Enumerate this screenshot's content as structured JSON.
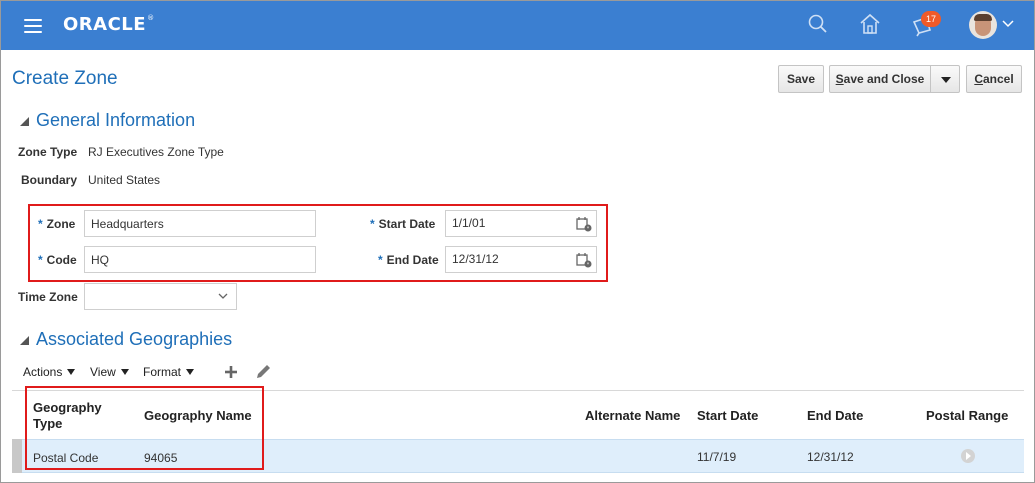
{
  "header": {
    "logo": "ORACLE",
    "logo_mark": "®",
    "notification_count": "17",
    "icons": [
      "menu-icon",
      "search-icon",
      "home-icon",
      "notifications-icon",
      "avatar",
      "chevron-down-icon"
    ]
  },
  "page": {
    "title": "Create Zone",
    "buttons": {
      "save": "Save",
      "save_and_close": "Save and Close",
      "cancel": "Cancel"
    }
  },
  "general_info": {
    "heading": "General Information",
    "zone_type_label": "Zone Type",
    "zone_type_value": "RJ Executives Zone Type",
    "boundary_label": "Boundary",
    "boundary_value": "United States",
    "required_mark": "*",
    "zone_label": "Zone",
    "zone_value": "Headquarters",
    "code_label": "Code",
    "code_value": "HQ",
    "start_date_label": "Start Date",
    "start_date_value": "1/1/01",
    "end_date_label": "End Date",
    "end_date_value": "12/31/12",
    "time_zone_label": "Time Zone",
    "time_zone_value": ""
  },
  "geographies": {
    "heading": "Associated Geographies",
    "toolbar": {
      "actions": "Actions",
      "view": "View",
      "format": "Format"
    },
    "columns": {
      "geography_type": "Geography Type",
      "geography_name": "Geography Name",
      "alternate_name": "Alternate Name",
      "start_date": "Start Date",
      "end_date": "End Date",
      "postal_range": "Postal Range"
    },
    "rows": [
      {
        "geography_type": "Postal Code",
        "geography_name": "94065",
        "alternate_name": "",
        "start_date": "11/7/19",
        "end_date": "12/31/12"
      }
    ]
  },
  "colors": {
    "header_bg": "#3b7fd1",
    "accent": "#1f6fb8",
    "highlight": "#e01b1b",
    "badge": "#f05a28",
    "selected_row": "#dfeefb"
  }
}
